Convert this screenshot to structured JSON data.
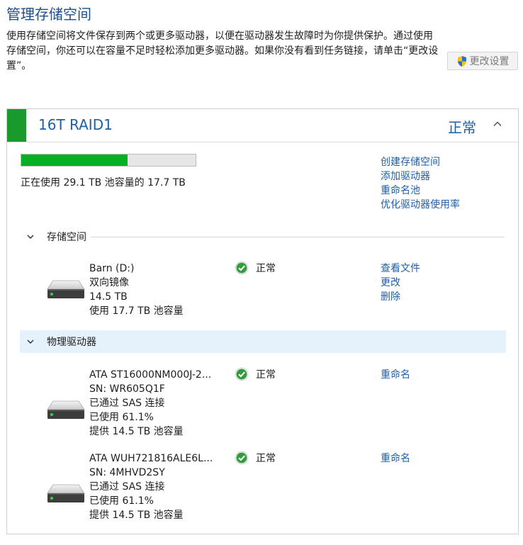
{
  "page": {
    "title": "管理存储空间",
    "intro": "使用存储空间将文件保存到两个或更多驱动器，以便在驱动器发生故障时为你提供保护。通过使用存储空间，你还可以在容量不足时轻松添加更多驱动器。如果你没有看到任务链接，请单击“更改设置”。",
    "change_settings": "更改设置"
  },
  "pool": {
    "name": "16T RAID1",
    "status": "正常",
    "usage_fraction": 0.61,
    "usage_text": "正在使用 29.1 TB 池容量的 17.7 TB",
    "links": [
      "创建存储空间",
      "添加驱动器",
      "重命名池",
      "优化驱动器使用率"
    ]
  },
  "storage_spaces": {
    "header": "存储空间",
    "items": [
      {
        "name": "Barn (D:)",
        "type": "双向镜像",
        "size": "14.5 TB",
        "usage": "使用 17.7 TB 池容量",
        "status": "正常",
        "links": [
          "查看文件",
          "更改",
          "删除"
        ]
      }
    ]
  },
  "physical_drives": {
    "header": "物理驱动器",
    "items": [
      {
        "name": "ATA ST16000NM000J-2...",
        "sn": "SN: WR605Q1F",
        "connection": "已通过 SAS 连接",
        "used": "已使用 61.1%",
        "capacity": "提供 14.5 TB 池容量",
        "status": "正常",
        "link": "重命名"
      },
      {
        "name": "ATA WUH721816ALE6L...",
        "sn": "SN: 4MHVD2SY",
        "connection": "已通过 SAS 连接",
        "used": "已使用 61.1%",
        "capacity": "提供 14.5 TB 池容量",
        "status": "正常",
        "link": "重命名"
      }
    ]
  },
  "colors": {
    "accent": "#1e5fa8",
    "title": "#1e4e8c",
    "ok_green": "#1a9a2c",
    "bar_fill": "#06b025"
  },
  "icons": [
    "uac-shield-icon",
    "chevron-up-icon",
    "chevron-down-icon",
    "ok-check-icon",
    "hard-drive-icon"
  ]
}
